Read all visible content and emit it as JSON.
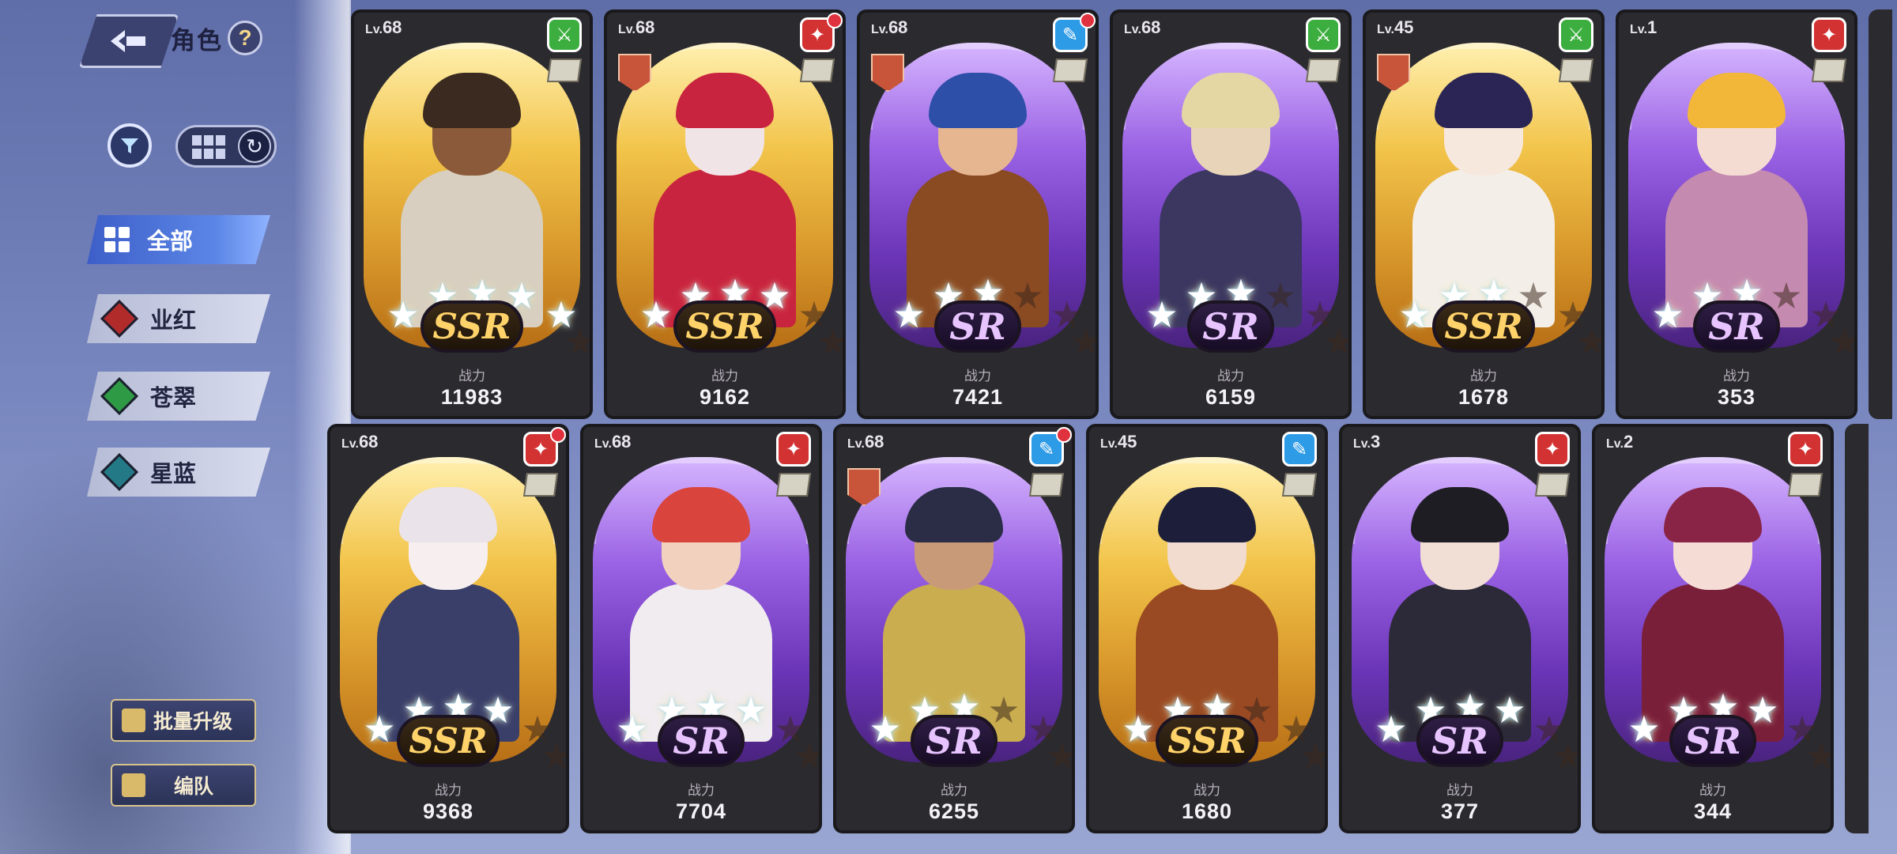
{
  "header": {
    "title": "角色",
    "help_glyph": "?",
    "back_icon": "back-arrow-icon"
  },
  "toolbar": {
    "filter_icon": "filter-icon",
    "view_icon": "grid-view-icon",
    "refresh_icon": "refresh-icon"
  },
  "categories": [
    {
      "label": "全部",
      "active": true,
      "color": "#4b74dc"
    },
    {
      "label": "业红",
      "active": false,
      "color": "#b22b2b"
    },
    {
      "label": "苍翠",
      "active": false,
      "color": "#2f9a45"
    },
    {
      "label": "星蓝",
      "active": false,
      "color": "#237a86"
    }
  ],
  "side_buttons": {
    "batch_upgrade": "批量升级",
    "formation": "编队"
  },
  "power_label": "战力",
  "cards": [
    {
      "level": "68",
      "element": "green",
      "red_dot": false,
      "crest": false,
      "rarity": "SSR",
      "stars": 5,
      "power": "11983",
      "skin": "#8a5a3a",
      "hair": "#3a2a1f",
      "outfit": "#d8cfc0"
    },
    {
      "level": "68",
      "element": "red",
      "red_dot": true,
      "crest": true,
      "rarity": "SSR",
      "stars": 4,
      "power": "9162",
      "skin": "#f1e4e6",
      "hair": "#c9243f",
      "outfit": "#c9243f"
    },
    {
      "level": "68",
      "element": "blue",
      "red_dot": true,
      "crest": true,
      "rarity": "SR",
      "stars": 3,
      "power": "7421",
      "skin": "#e5b68f",
      "hair": "#2d4fa8",
      "outfit": "#8a4a22"
    },
    {
      "level": "68",
      "element": "green",
      "red_dot": false,
      "crest": false,
      "rarity": "SR",
      "stars": 3,
      "power": "6159",
      "skin": "#e8d4b8",
      "hair": "#e4d7a3",
      "outfit": "#3b3760"
    },
    {
      "level": "45",
      "element": "green",
      "red_dot": false,
      "crest": true,
      "rarity": "SSR",
      "stars": 3,
      "power": "1678",
      "skin": "#f7e8de",
      "hair": "#2b2555",
      "outfit": "#f3efe8"
    },
    {
      "level": "1",
      "element": "red",
      "red_dot": false,
      "crest": false,
      "rarity": "SR",
      "stars": 3,
      "power": "353",
      "skin": "#f5dcd3",
      "hair": "#f2b738",
      "outfit": "#c58ab0"
    },
    {
      "level": "68",
      "element": "red",
      "red_dot": true,
      "crest": false,
      "rarity": "SSR",
      "stars": 4,
      "power": "9368",
      "skin": "#f7eef0",
      "hair": "#eae3ea",
      "outfit": "#3a3f6a"
    },
    {
      "level": "68",
      "element": "red",
      "red_dot": false,
      "crest": false,
      "rarity": "SR",
      "stars": 4,
      "power": "7704",
      "skin": "#f2d2bf",
      "hair": "#d9453c",
      "outfit": "#f0ecef"
    },
    {
      "level": "68",
      "element": "blue",
      "red_dot": true,
      "crest": true,
      "rarity": "SR",
      "stars": 3,
      "power": "6255",
      "skin": "#c99a78",
      "hair": "#2a2d45",
      "outfit": "#c9ad4f"
    },
    {
      "level": "45",
      "element": "blue",
      "red_dot": false,
      "crest": false,
      "rarity": "SSR",
      "stars": 3,
      "power": "1680",
      "skin": "#f2dccf",
      "hair": "#1d1f3a",
      "outfit": "#9a4a22"
    },
    {
      "level": "3",
      "element": "red",
      "red_dot": false,
      "crest": false,
      "rarity": "SR",
      "stars": 4,
      "power": "377",
      "skin": "#f1dfd5",
      "hair": "#1f1d24",
      "outfit": "#2c2a38"
    },
    {
      "level": "2",
      "element": "red",
      "red_dot": false,
      "crest": false,
      "rarity": "SR",
      "stars": 4,
      "power": "344",
      "skin": "#f5ddd6",
      "hair": "#8a2446",
      "outfit": "#7a1f3a"
    }
  ],
  "level_prefix": "Lv."
}
